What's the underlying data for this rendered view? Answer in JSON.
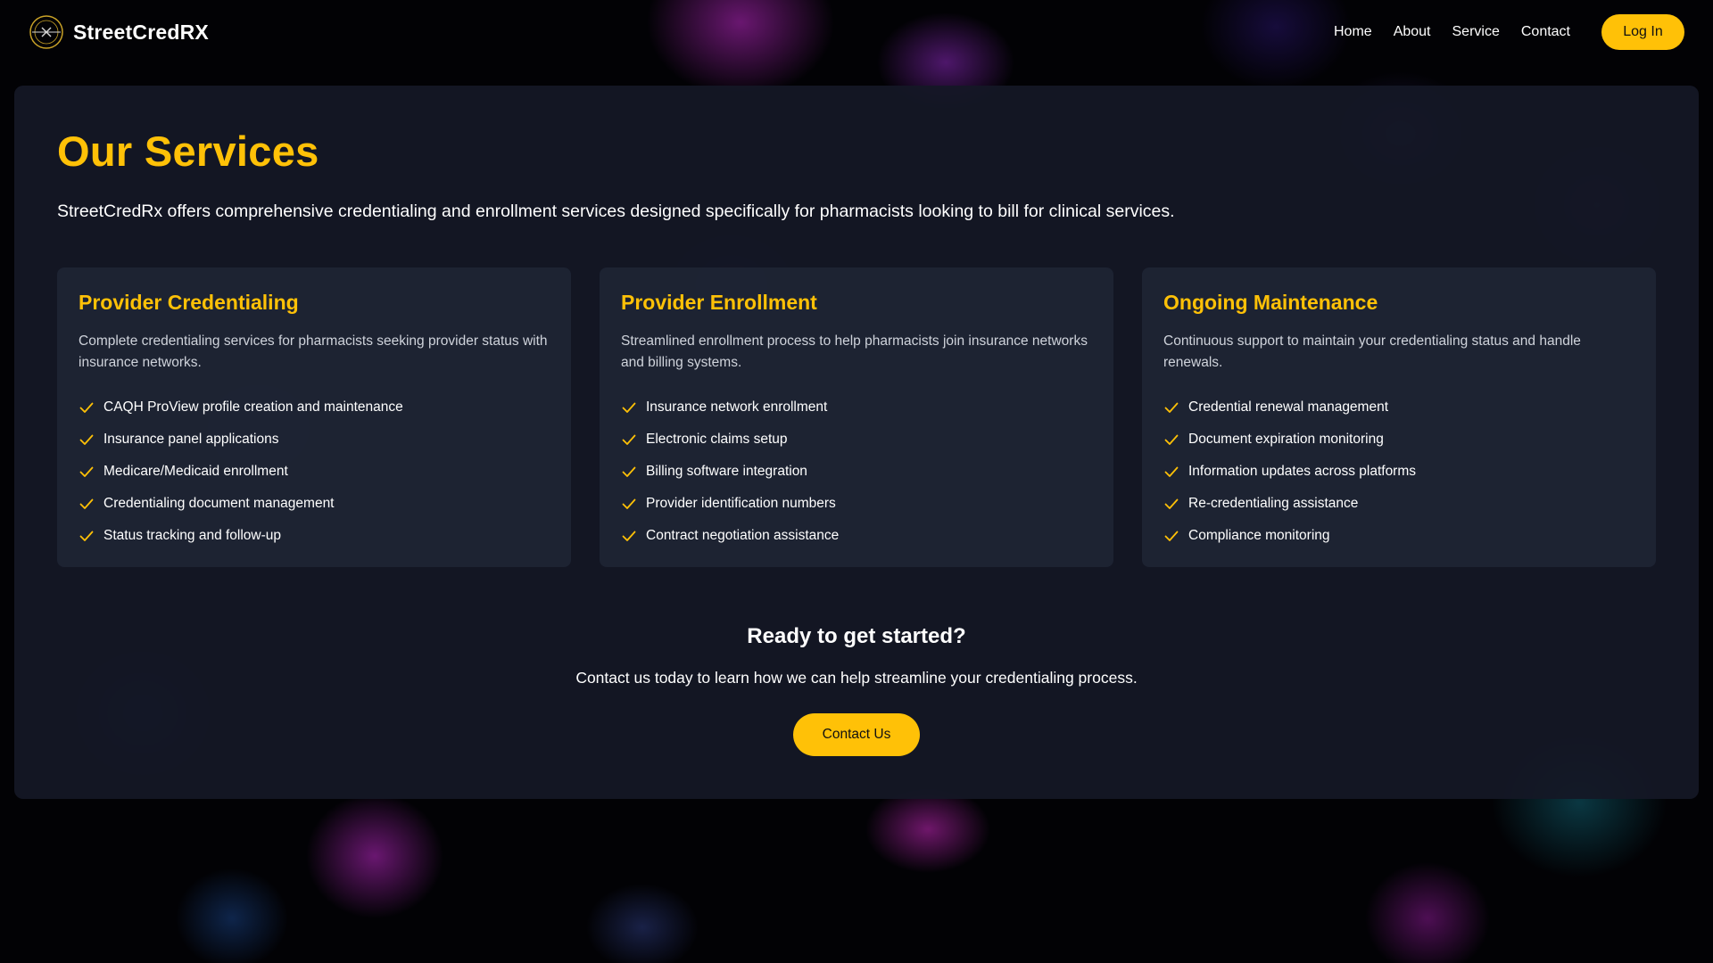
{
  "header": {
    "brand": "StreetCredRX",
    "nav": [
      "Home",
      "About",
      "Service",
      "Contact"
    ],
    "login_label": "Log In"
  },
  "main": {
    "title": "Our Services",
    "intro": "StreetCredRx offers comprehensive credentialing and enrollment services designed specifically for pharmacists looking to bill for clinical services.",
    "cards": [
      {
        "title": "Provider Credentialing",
        "description": "Complete credentialing services for pharmacists seeking provider status with insurance networks.",
        "features": [
          "CAQH ProView profile creation and maintenance",
          "Insurance panel applications",
          "Medicare/Medicaid enrollment",
          "Credentialing document management",
          "Status tracking and follow-up"
        ]
      },
      {
        "title": "Provider Enrollment",
        "description": "Streamlined enrollment process to help pharmacists join insurance networks and billing systems.",
        "features": [
          "Insurance network enrollment",
          "Electronic claims setup",
          "Billing software integration",
          "Provider identification numbers",
          "Contract negotiation assistance"
        ]
      },
      {
        "title": "Ongoing Maintenance",
        "description": "Continuous support to maintain your credentialing status and handle renewals.",
        "features": [
          "Credential renewal management",
          "Document expiration monitoring",
          "Information updates across platforms",
          "Re-credentialing assistance",
          "Compliance monitoring"
        ]
      }
    ],
    "cta": {
      "title": "Ready to get started?",
      "text": "Contact us today to learn how we can help streamline your credentialing process.",
      "button": "Contact Us"
    }
  },
  "colors": {
    "accent": "#ffc107",
    "panel": "#141826",
    "card": "#1e2434"
  },
  "icons": {
    "logo": "compass-logo-icon",
    "feature": "check-icon"
  }
}
